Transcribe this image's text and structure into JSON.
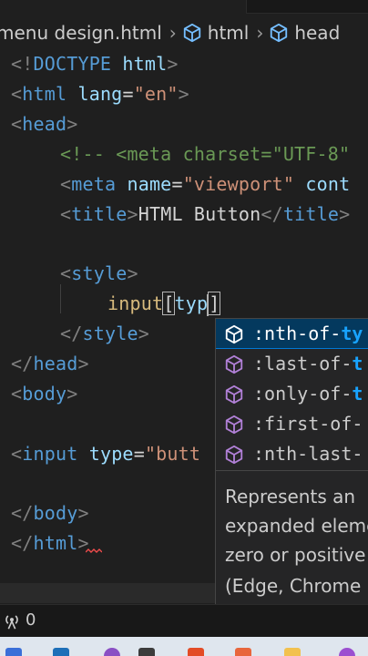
{
  "breadcrumb": {
    "file": "menu design.html",
    "items": [
      "html",
      "head"
    ]
  },
  "code": {
    "l1": {
      "a": "<!",
      "b": "DOCTYPE",
      "c": " html",
      "d": ">"
    },
    "l2": {
      "a": "<",
      "b": "html",
      "c": " lang",
      "d": "=",
      "e": "\"en\"",
      "f": ">"
    },
    "l3": {
      "a": "<",
      "b": "head",
      "c": ">"
    },
    "l4": "<!-- <meta charset=\"UTF-8\"",
    "l5": {
      "a": "<",
      "b": "meta",
      "c": " name",
      "d": "=",
      "e": "\"viewport\"",
      "f": " cont"
    },
    "l6": {
      "a": "<",
      "b": "title",
      "c": ">",
      "d": "HTML Button",
      "e": "</",
      "f": "title",
      "g": ">"
    },
    "l8": {
      "a": "<",
      "b": "style",
      "c": ">"
    },
    "l9": {
      "a": "input",
      "b": "[",
      "c": "typ",
      "d": "]"
    },
    "l10": {
      "a": "</",
      "b": "style",
      "c": ">"
    },
    "l11": {
      "a": "</",
      "b": "head",
      "c": ">"
    },
    "l12": {
      "a": "<",
      "b": "body",
      "c": ">"
    },
    "l14": {
      "a": "<",
      "b": "input",
      "c": " type",
      "d": "=",
      "e": "\"butt"
    },
    "l16": {
      "a": "</",
      "b": "body",
      "c": ">"
    },
    "l17": {
      "a": "</",
      "b": "html",
      "c": ">"
    }
  },
  "suggestions": {
    "items": [
      {
        "match": ":nth-of-",
        "rest": "ty"
      },
      {
        "match": ":last-of-",
        "rest": "t"
      },
      {
        "match": ":only-of-",
        "rest": "t"
      },
      {
        "match": ":first-of-",
        "rest": ""
      },
      {
        "match": ":nth-last-",
        "rest": ""
      }
    ],
    "docs": [
      "Represents an",
      "expanded eleme",
      "zero or positive",
      "(Edge, Chrome"
    ]
  },
  "status": {
    "ports_count": "0"
  },
  "colors": {
    "tag": "#569cd6",
    "attribute": "#9cdcfe",
    "string": "#ce9178",
    "comment": "#6a9955",
    "selector": "#d7ba7d",
    "highlight": "#18a3ff",
    "symbol_icon": "#b180d7",
    "active_row": "#04395e"
  }
}
